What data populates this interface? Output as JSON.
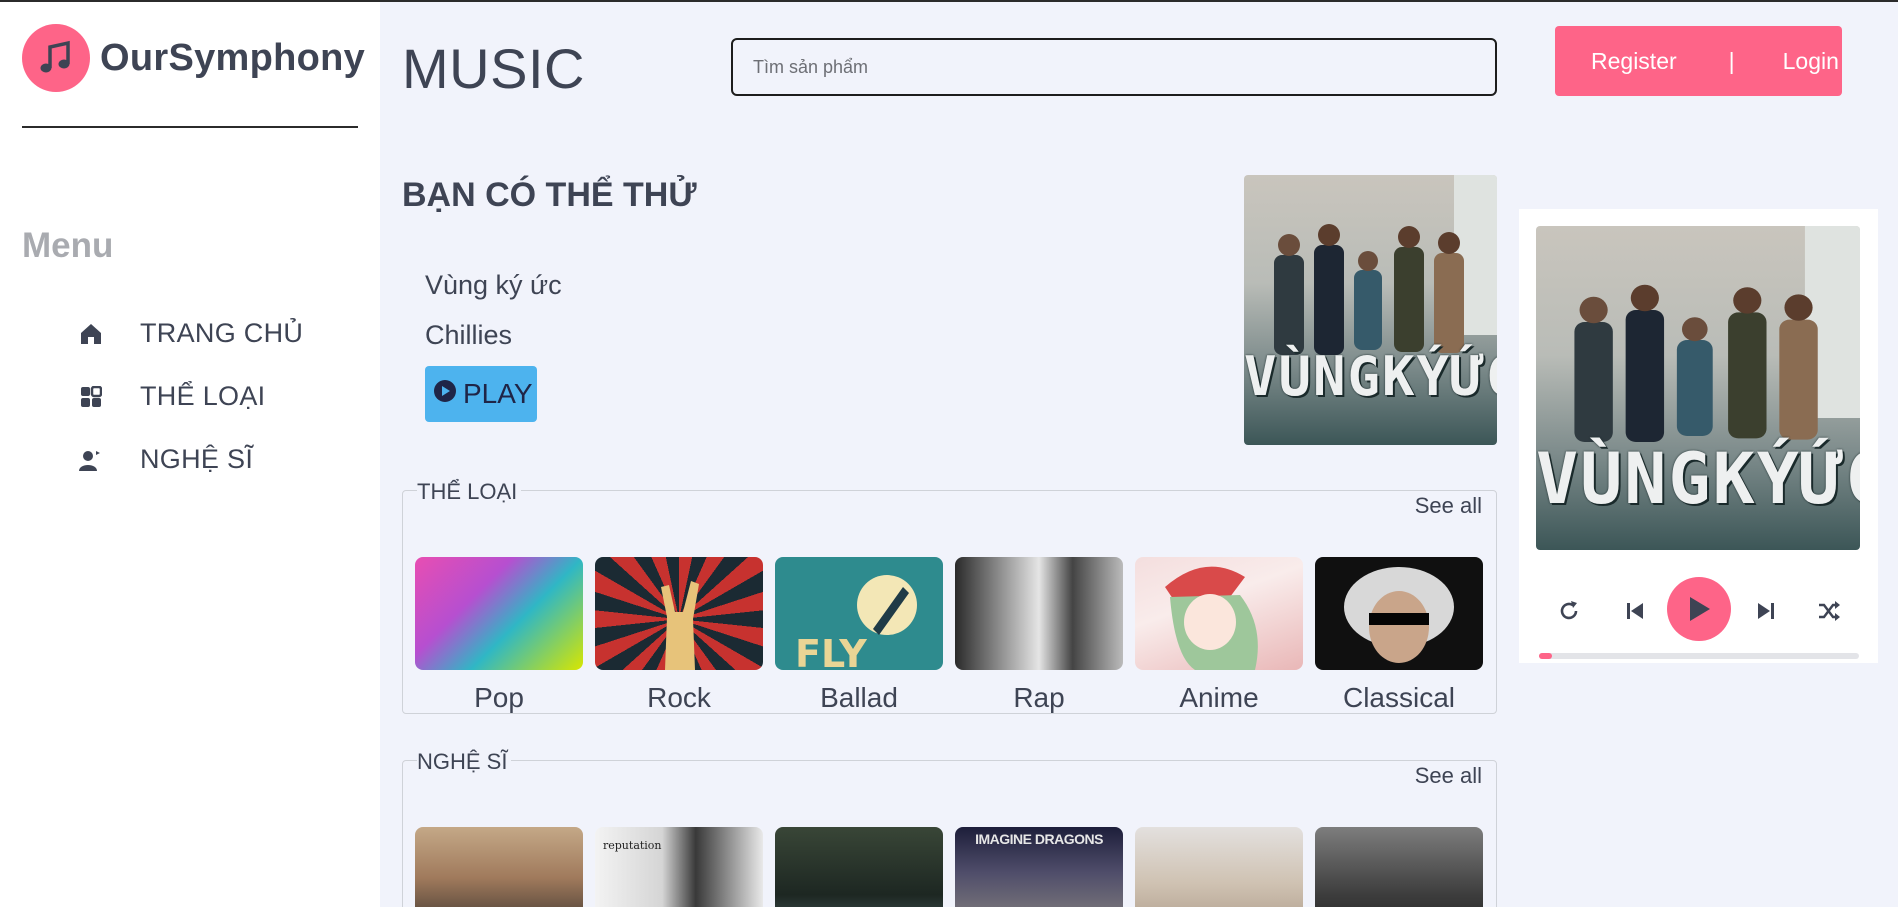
{
  "brand": {
    "name": "OurSymphony",
    "logo_icon": "music-note-icon"
  },
  "sidebar": {
    "menu_title": "Menu",
    "items": [
      {
        "label": "TRANG CHỦ",
        "icon": "home-icon"
      },
      {
        "label": "THỂ LOẠI",
        "icon": "grid-icon"
      },
      {
        "label": "NGHỆ SĨ",
        "icon": "artist-icon"
      }
    ]
  },
  "header": {
    "title": "MUSIC",
    "search_placeholder": "Tìm sản phẩm",
    "register_label": "Register",
    "separator": "|",
    "login_label": "Login"
  },
  "suggestion": {
    "title": "BẠN CÓ THỂ THỬ",
    "song": "Vùng ký ức",
    "artist": "Chillies",
    "play_label": "PLAY",
    "cover_text": "VÙNGKÝỨC"
  },
  "genres": {
    "title": "THỂ LOẠI",
    "see_all": "See all",
    "items": [
      {
        "label": "Pop"
      },
      {
        "label": "Rock"
      },
      {
        "label": "Ballad"
      },
      {
        "label": "Rap"
      },
      {
        "label": "Anime"
      },
      {
        "label": "Classical"
      }
    ]
  },
  "artists": {
    "title": "NGHỆ SĨ",
    "see_all": "See all",
    "thumb_texts": [
      "reputation",
      "IMAGINE DRAGONS"
    ]
  },
  "player": {
    "cover_text": "VÙNGKÝỨC",
    "progress": 0.04,
    "controls": [
      "repeat-icon",
      "previous-icon",
      "play-icon",
      "next-icon",
      "shuffle-icon"
    ]
  },
  "colors": {
    "accent": "#fe6488",
    "play_button": "#4db3ee",
    "text": "#3e4454",
    "background": "#f1f3fb"
  }
}
